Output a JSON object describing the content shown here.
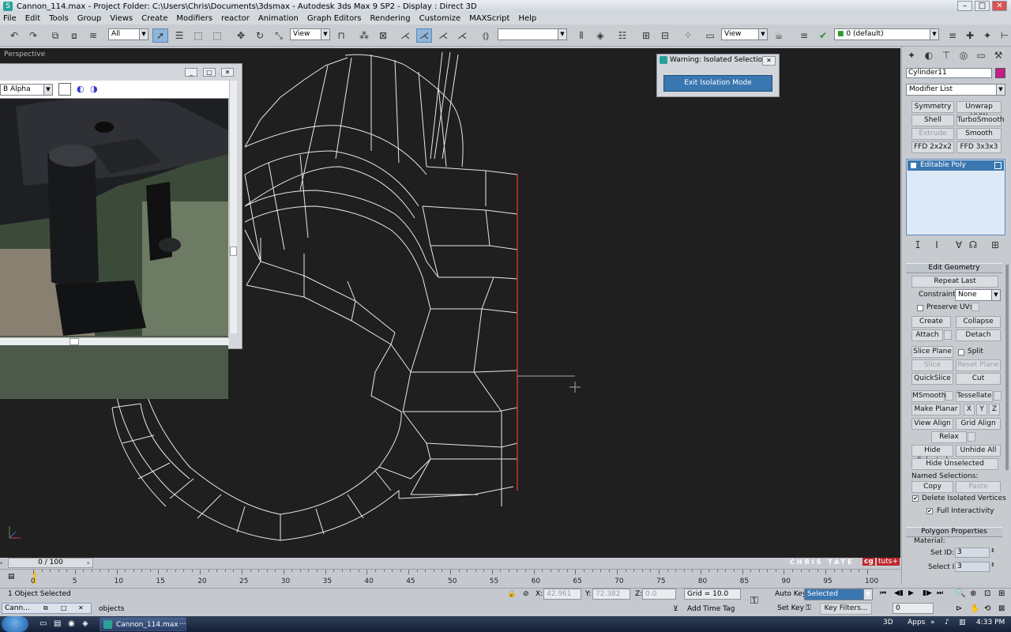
{
  "window": {
    "title": "Cannon_114.max    - Project Folder: C:\\Users\\Chris\\Documents\\3dsmax    - Autodesk 3ds Max 9 SP2    - Display : Direct 3D"
  },
  "menu": [
    "File",
    "Edit",
    "Tools",
    "Group",
    "Views",
    "Create",
    "Modifiers",
    "reactor",
    "Animation",
    "Graph Editors",
    "Rendering",
    "Customize",
    "MAXScript",
    "Help"
  ],
  "toolbar": {
    "selection_filter": "All",
    "ref_coord": "View",
    "named_selection": "",
    "view2": "View",
    "layer": "0 (default)"
  },
  "viewport": {
    "label": "Perspective"
  },
  "image_window": {
    "channel": "B Alpha"
  },
  "isolate": {
    "title": "Warning: Isolated Selection",
    "button": "Exit Isolation Mode"
  },
  "panel": {
    "object_name": "Cylinder11",
    "object_color": "#c41e8a",
    "modifier_list": "Modifier List",
    "mod_buttons": [
      "Symmetry",
      "Unwrap UVW",
      "Shell",
      "TurboSmooth",
      "Extrude",
      "Smooth",
      "FFD 2x2x2",
      "FFD 3x3x3"
    ],
    "stack_item": "Editable Poly",
    "edit_geometry": {
      "title": "Edit Geometry",
      "repeat_last": "Repeat Last",
      "constraints_label": "Constraints:",
      "constraints_value": "None",
      "preserve_uvs": "Preserve UVs",
      "create": "Create",
      "collapse": "Collapse",
      "attach": "Attach",
      "detach": "Detach",
      "slice_plane": "Slice Plane",
      "split": "Split",
      "slice": "Slice",
      "reset_plane": "Reset Plane",
      "quickslice": "QuickSlice",
      "cut": "Cut",
      "msmooth": "MSmooth",
      "tessellate": "Tessellate",
      "make_planar": "Make Planar",
      "x": "X",
      "y": "Y",
      "z": "Z",
      "view_align": "View Align",
      "grid_align": "Grid Align",
      "relax": "Relax",
      "hide_selected": "Hide Selected",
      "unhide_all": "Unhide All",
      "hide_unselected": "Hide Unselected",
      "named_selections": "Named Selections:",
      "copy": "Copy",
      "paste": "Paste",
      "delete_isolated": "Delete Isolated Vertices",
      "full_interactivity": "Full Interactivity"
    },
    "polygon_properties": {
      "title": "Polygon Properties",
      "material": "Material:",
      "set_id_label": "Set ID:",
      "set_id": "3",
      "select_id_label": "Select ID",
      "select_id": "3"
    }
  },
  "timeline": {
    "frame": "0 / 100",
    "ticks": [
      "0",
      "5",
      "10",
      "15",
      "20",
      "25",
      "30",
      "35",
      "40",
      "45",
      "50",
      "55",
      "60",
      "65",
      "70",
      "75",
      "80",
      "85",
      "90",
      "95",
      "100"
    ]
  },
  "watermark": {
    "author": "CHRIS TATE",
    "brand": "tuts+",
    "cg": "cg"
  },
  "status": {
    "selected": "1 Object Selected",
    "objects": "objects",
    "x_label": "X:",
    "x": "42.961",
    "y_label": "Y:",
    "y": "72.382",
    "z_label": "Z:",
    "z": "0.0",
    "grid": "Grid = 10.0",
    "add_time_tag": "Add Time Tag",
    "auto_key": "Auto Key",
    "set_key": "Set Key",
    "key_mode": "Selected",
    "key_filters": "Key Filters...",
    "frame_field": "0",
    "mini_title": "Cann..."
  },
  "taskbar": {
    "task": "Cannon_114.max",
    "ellipsis": "...",
    "lang": "3D",
    "apps": "Apps",
    "time": "4:33 PM"
  }
}
